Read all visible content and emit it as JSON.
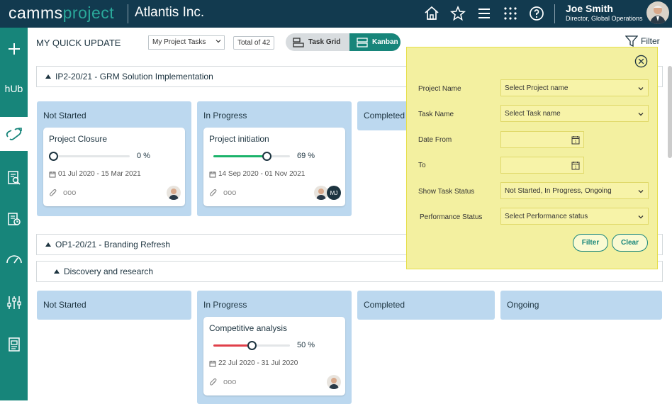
{
  "header": {
    "logo_part1": "camms",
    "logo_part2": "project",
    "org_name": "Atlantis Inc.",
    "user_name": "Joe Smith",
    "user_role": "Director, Global Operations"
  },
  "sidebar": {
    "items": [
      "add-icon",
      "hub-label",
      "link-icon",
      "report-icon",
      "calendar-icon",
      "gauge-icon",
      "sliders-icon",
      "document-icon"
    ],
    "hub_text": "hUb"
  },
  "toolbar": {
    "title": "MY QUICK UPDATE",
    "select_value": "My Project Tasks",
    "total": "Total of 42",
    "task_grid": "Task Grid",
    "kanban": "Kanban",
    "filter": "Filter"
  },
  "projects": [
    {
      "name": "IP2-20/21 - GRM Solution Implementation",
      "columns": [
        "Not Started",
        "In Progress",
        "Completed"
      ],
      "cards": [
        {
          "title": "Project Closure",
          "progress": 0,
          "pct": "0 %",
          "dates": "01 Jul 2020 - 15 Mar 2021",
          "more": "ooo"
        },
        {
          "title": "Project initiation",
          "progress": 69,
          "pct": "69 %",
          "dates": "14 Sep 2020 - 01 Nov 2021",
          "more": "ooo",
          "initials": "MJ"
        }
      ]
    },
    {
      "name": "OP1-20/21 - Branding Refresh",
      "sub": "Discovery and research",
      "columns": [
        "Not Started",
        "In Progress",
        "Completed",
        "Ongoing"
      ],
      "cards": [
        {
          "title": "Competitive analysis",
          "progress": 50,
          "pct": "50 %",
          "dates": "22 Jul 2020 - 31 Jul 2020",
          "more": "ooo"
        }
      ]
    }
  ],
  "filter_panel": {
    "labels": [
      "Project Name",
      "Task Name",
      "Date From",
      "To",
      "Show Task Status",
      "Performance Status"
    ],
    "project_name": "Select Project name",
    "task_name": "Select Task name",
    "date_from": "",
    "date_to": "",
    "task_status": "Not Started, In Progress, Ongoing",
    "performance_status": "Select Performance status",
    "filter_btn": "Filter",
    "clear_btn": "Clear"
  },
  "colors": {
    "header": "#123a4f",
    "teal": "#17857a",
    "column": "#bcd8ef",
    "panel": "#f3f0a0",
    "progress_green": "#1bb36a",
    "progress_red": "#e0404a"
  }
}
